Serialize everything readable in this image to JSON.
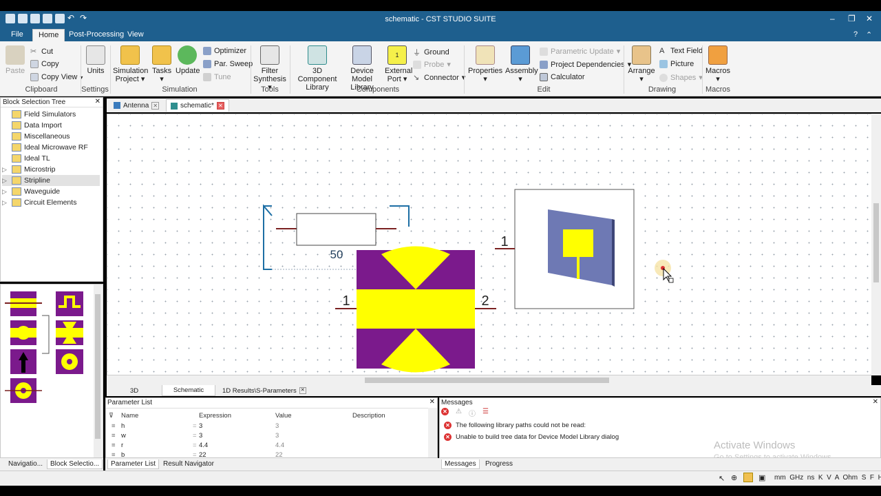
{
  "window": {
    "title": "schematic - CST STUDIO SUITE"
  },
  "menu": {
    "file": "File",
    "home": "Home",
    "post": "Post-Processing",
    "view": "View"
  },
  "ribbon": {
    "clipboard": {
      "paste": "Paste",
      "cut": "Cut",
      "copy": "Copy",
      "copy_view": "Copy View",
      "label": "Clipboard"
    },
    "settings": {
      "units": "Units",
      "label": "Settings"
    },
    "simulation": {
      "project1": "Simulation",
      "project2": "Project",
      "tasks": "Tasks",
      "update": "Update",
      "optimizer": "Optimizer",
      "par_sweep": "Par. Sweep",
      "tune": "Tune",
      "label": "Simulation"
    },
    "tools": {
      "filter1": "Filter",
      "filter2": "Synthesis",
      "label": "Tools"
    },
    "components": {
      "lib1": "3D Component",
      "lib2": "Library",
      "dev1": "Device Model",
      "dev2": "Library",
      "ext1": "External",
      "ext2": "Port",
      "ground": "Ground",
      "probe": "Probe",
      "connector": "Connector",
      "label": "Components"
    },
    "edit": {
      "properties": "Properties",
      "assembly": "Assembly",
      "param_update": "Parametric Update",
      "proj_dep": "Project Dependencies",
      "calculator": "Calculator",
      "label": "Edit"
    },
    "drawing": {
      "arrange": "Arrange",
      "text_field": "Text Field",
      "picture": "Picture",
      "shapes": "Shapes",
      "label": "Drawing"
    },
    "macros": {
      "macros": "Macros",
      "label": "Macros"
    }
  },
  "left_panel": {
    "title": "Block Selection Tree",
    "items": [
      {
        "label": "Field Simulators",
        "arrow": ""
      },
      {
        "label": "Data Import",
        "arrow": ""
      },
      {
        "label": "Miscellaneous",
        "arrow": ""
      },
      {
        "label": "Ideal Microwave RF",
        "arrow": ""
      },
      {
        "label": "Ideal TL",
        "arrow": ""
      },
      {
        "label": "Microstrip",
        "arrow": "▷"
      },
      {
        "label": "Stripline",
        "arrow": "▷"
      },
      {
        "label": "Waveguide",
        "arrow": "▷"
      },
      {
        "label": "Circuit Elements",
        "arrow": "▷"
      }
    ],
    "bottom_tabs": {
      "nav": "Navigatio...",
      "block": "Block Selectio..."
    }
  },
  "doc_tabs": {
    "antenna": "Antenna",
    "schematic": "schematic*"
  },
  "schematic": {
    "resistor_value": "50",
    "port1": "1",
    "port2": "2",
    "block_port1": "1"
  },
  "view_tabs": {
    "t3d": "3D",
    "schematic": "Schematic",
    "results": "1D Results\\S-Parameters"
  },
  "param_list": {
    "title": "Parameter List",
    "cols": {
      "name": "Name",
      "expr": "Expression",
      "value": "Value",
      "desc": "Description"
    },
    "rows": [
      {
        "name": "h",
        "expr": "3",
        "value": "3"
      },
      {
        "name": "w",
        "expr": "3",
        "value": "3"
      },
      {
        "name": "r",
        "expr": "4.4",
        "value": "4.4"
      },
      {
        "name": "b",
        "expr": "22",
        "value": "22"
      }
    ],
    "tabs": {
      "params": "Parameter List",
      "results": "Result Navigator"
    }
  },
  "messages": {
    "title": "Messages",
    "items": [
      "The following library paths could not be read:",
      "Unable to build tree data for Device Model Library dialog"
    ],
    "tabs": {
      "messages": "Messages",
      "progress": "Progress"
    },
    "watermark1": "Activate Windows",
    "watermark2": "Go to Settings to activate Windows."
  },
  "statusbar": {
    "units": "mm  GHz  ns  K  V  A  Ohm  S  F  H"
  },
  "colors": {
    "titlebar": "#1e5f8e",
    "purple": "#7b1a8c",
    "yellow": "#ffff00",
    "antenna_blue": "#6e79b4"
  }
}
